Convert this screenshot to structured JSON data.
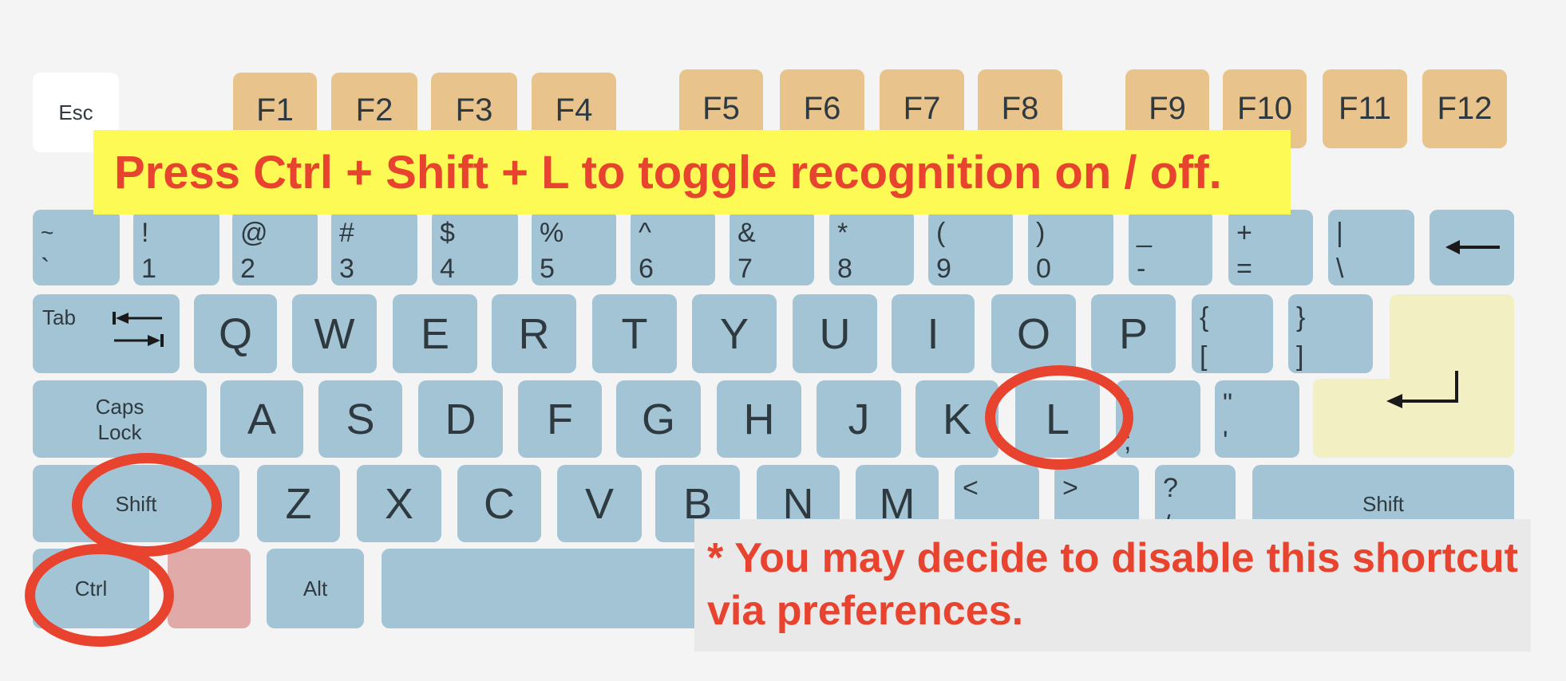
{
  "function_row": {
    "esc": "Esc",
    "keys": [
      "F1",
      "F2",
      "F3",
      "F4",
      "F5",
      "F6",
      "F7",
      "F8",
      "F9",
      "F10",
      "F11",
      "F12"
    ]
  },
  "number_row": [
    {
      "top": "~",
      "bottom": "`"
    },
    {
      "top": "!",
      "bottom": "1"
    },
    {
      "top": "@",
      "bottom": "2"
    },
    {
      "top": "#",
      "bottom": "3"
    },
    {
      "top": "$",
      "bottom": "4"
    },
    {
      "top": "%",
      "bottom": "5"
    },
    {
      "top": "^",
      "bottom": "6"
    },
    {
      "top": "&",
      "bottom": "7"
    },
    {
      "top": "*",
      "bottom": "8"
    },
    {
      "top": "(",
      "bottom": "9"
    },
    {
      "top": ")",
      "bottom": "0"
    },
    {
      "top": "_",
      "bottom": "-"
    },
    {
      "top": "+",
      "bottom": "="
    },
    {
      "top": "|",
      "bottom": "\\"
    }
  ],
  "qwerty_row": {
    "tab": "Tab",
    "letters": [
      "Q",
      "W",
      "E",
      "R",
      "T",
      "Y",
      "U",
      "I",
      "O",
      "P"
    ],
    "brackets": [
      {
        "top": "{",
        "bottom": "["
      },
      {
        "top": "}",
        "bottom": "]"
      }
    ]
  },
  "home_row": {
    "caps_line1": "Caps",
    "caps_line2": "Lock",
    "letters": [
      "A",
      "S",
      "D",
      "F",
      "G",
      "H",
      "J",
      "K",
      "L"
    ],
    "punct": [
      {
        "top": ":",
        "bottom": ";"
      },
      {
        "top": "\"",
        "bottom": "'"
      }
    ]
  },
  "shift_row": {
    "left_shift": "Shift",
    "letters": [
      "Z",
      "X",
      "C",
      "V",
      "B",
      "N",
      "M"
    ],
    "punct": [
      {
        "top": "<",
        "bottom": ","
      },
      {
        "top": ">",
        "bottom": "."
      },
      {
        "top": "?",
        "bottom": "/"
      }
    ],
    "right_shift": "Shift"
  },
  "bottom_row": {
    "ctrl": "Ctrl",
    "alt": "Alt"
  },
  "banner_text": "Press Ctrl + Shift + L to toggle recognition on / off.",
  "note_text": "* You may decide to disable this shortcut via preferences.",
  "colors": {
    "key": "#a3c4d5",
    "function_key": "#e9c38c",
    "enter_key": "#f2efc3",
    "fn_key": "#e0aaa8",
    "highlight": "#e8432e",
    "banner_bg": "#fdf955",
    "note_bg": "#e9e9e9"
  },
  "highlighted_keys": [
    "Ctrl",
    "Shift",
    "L"
  ]
}
